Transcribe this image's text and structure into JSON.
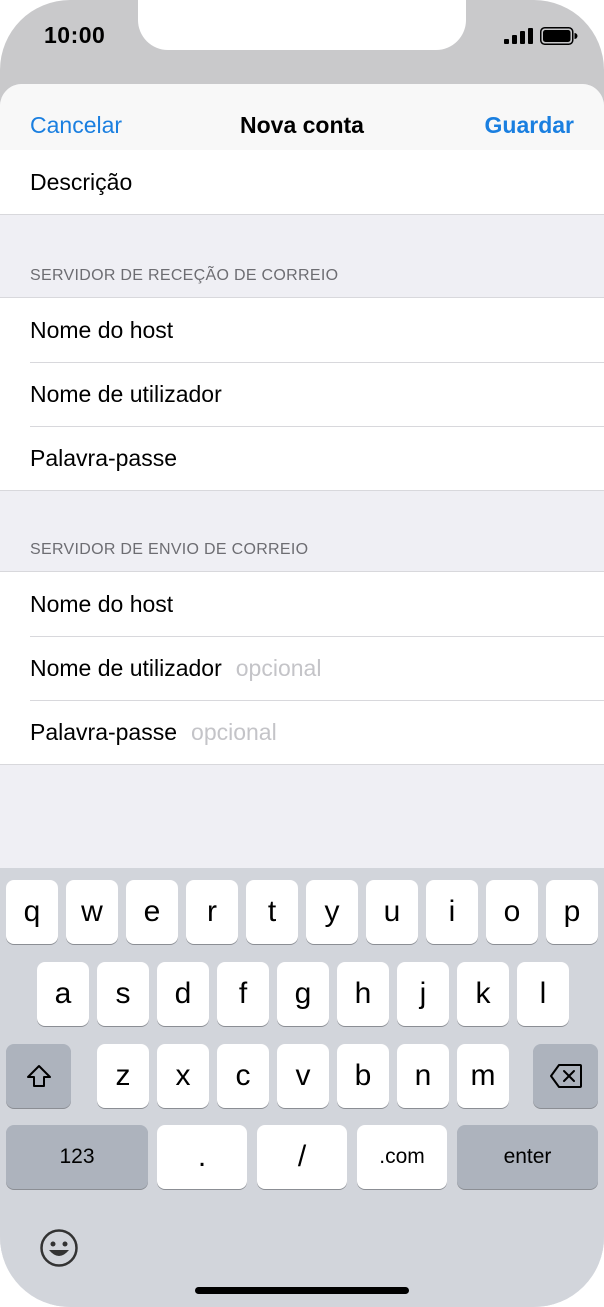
{
  "status_bar": {
    "time": "10:00",
    "icons": [
      "signal-icon",
      "battery-icon"
    ]
  },
  "nav": {
    "cancel_label": "Cancelar",
    "title": "Nova conta",
    "save_label": "Guardar"
  },
  "top_group": {
    "rows": [
      {
        "label": "Descrição",
        "placeholder": ""
      }
    ]
  },
  "incoming": {
    "header": "SERVIDOR DE RECEÇÃO DE CORREIO",
    "rows": [
      {
        "label": "Nome do host",
        "placeholder": ""
      },
      {
        "label": "Nome de utilizador",
        "placeholder": ""
      },
      {
        "label": "Palavra-passe",
        "placeholder": ""
      }
    ]
  },
  "outgoing": {
    "header": "SERVIDOR DE ENVIO DE CORREIO",
    "rows": [
      {
        "label": "Nome do host",
        "placeholder": ""
      },
      {
        "label": "Nome de utilizador",
        "placeholder": "opcional"
      },
      {
        "label": "Palavra-passe",
        "placeholder": "opcional"
      }
    ]
  },
  "keyboard": {
    "row1": [
      "q",
      "w",
      "e",
      "r",
      "t",
      "y",
      "u",
      "i",
      "o",
      "p"
    ],
    "row2": [
      "a",
      "s",
      "d",
      "f",
      "g",
      "h",
      "j",
      "k",
      "l"
    ],
    "row3": [
      "z",
      "x",
      "c",
      "v",
      "b",
      "n",
      "m"
    ],
    "numbers_label": "123",
    "dot_label": ".",
    "slash_label": "/",
    "dotcom_label": ".com",
    "enter_label": "enter",
    "icons": [
      "shift-icon",
      "backspace-icon",
      "emoji-icon"
    ]
  },
  "colors": {
    "accent": "#1a7fe0",
    "background": "#efeff4",
    "keyboard": "#d2d5db",
    "placeholder": "#c4c4c8"
  }
}
